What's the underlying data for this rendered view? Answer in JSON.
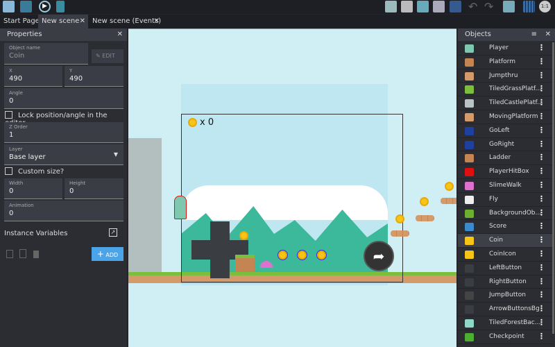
{
  "toolbar": {
    "icons": [
      "project-manager-icon",
      "scene-icon",
      "preview-play-icon",
      "debug-icon",
      "object-groups-icon",
      "instances-icon",
      "edit-icon",
      "list-icon",
      "layers-icon",
      "undo-icon",
      "redo-icon",
      "window-mask-icon",
      "grid-icon",
      "zoom-reset-icon"
    ],
    "zoom_label": "1:1"
  },
  "tabs": [
    {
      "label": "Start Page"
    },
    {
      "label": "New scene",
      "close": "✕",
      "active": true
    },
    {
      "label": "New scene (Events)",
      "close": "✕"
    }
  ],
  "properties": {
    "title": "Properties",
    "close": "✕",
    "object_name_label": "Object name",
    "object_name": "Coin",
    "edit_label": "EDIT",
    "x_label": "X",
    "x": "490",
    "y_label": "Y",
    "y": "490",
    "angle_label": "Angle",
    "angle": "0",
    "lock_label": "Lock position/angle in the editor",
    "zorder_label": "Z Order",
    "zorder": "1",
    "layer_label": "Layer",
    "layer": "Base layer",
    "custom_size_label": "Custom size?",
    "width_label": "Width",
    "width": "0",
    "height_label": "Height",
    "height": "0",
    "animation_label": "Animation",
    "animation": "0",
    "instance_vars_label": "Instance Variables",
    "add_label": "ADD"
  },
  "scene": {
    "score_text": "x 0"
  },
  "objects": {
    "title": "Objects",
    "close": "✕",
    "items": [
      {
        "name": "Player",
        "color": "#7fc8b0"
      },
      {
        "name": "Platform",
        "color": "#c48553"
      },
      {
        "name": "Jumpthru",
        "color": "#d59a6a"
      },
      {
        "name": "TiledGrassPlatf...",
        "color": "#7cbf3c"
      },
      {
        "name": "TiledCastlePlatf...",
        "color": "#b9c4c4"
      },
      {
        "name": "MovingPlatform",
        "color": "#d59a6a"
      },
      {
        "name": "GoLeft",
        "color": "#2040a0"
      },
      {
        "name": "GoRight",
        "color": "#2040a0"
      },
      {
        "name": "Ladder",
        "color": "#c48553"
      },
      {
        "name": "PlayerHitBox",
        "color": "#e01010"
      },
      {
        "name": "SlimeWalk",
        "color": "#e070d0"
      },
      {
        "name": "Fly",
        "color": "#eeeeee"
      },
      {
        "name": "BackgroundOb...",
        "color": "#6cb030"
      },
      {
        "name": "Score",
        "color": "#3a8ad0"
      },
      {
        "name": "Coin",
        "color": "#f6c516",
        "selected": true
      },
      {
        "name": "CoinIcon",
        "color": "#f6c516"
      },
      {
        "name": "LeftButton",
        "color": "#3a3d42"
      },
      {
        "name": "RightButton",
        "color": "#3a3d42"
      },
      {
        "name": "JumpButton",
        "color": "#444"
      },
      {
        "name": "ArrowButtonsBg",
        "color": "#3a3d42"
      },
      {
        "name": "TiledForestBac...",
        "color": "#8fd8c8"
      },
      {
        "name": "Checkpoint",
        "color": "#4caf30"
      }
    ]
  }
}
